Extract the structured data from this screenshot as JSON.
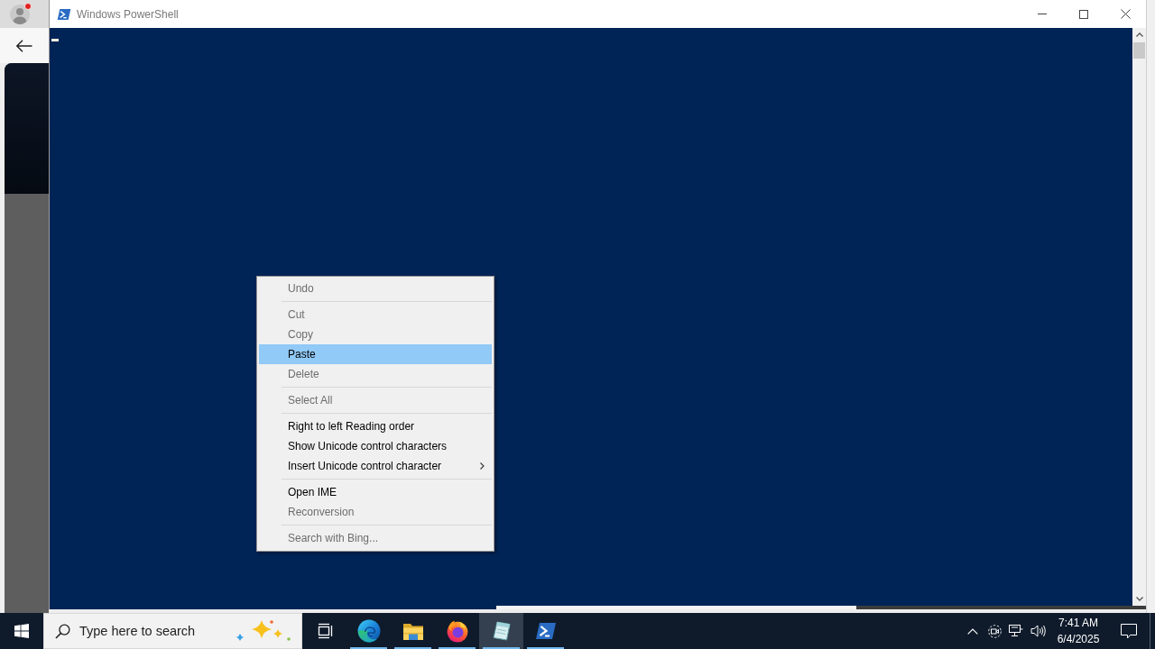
{
  "window": {
    "title": "Windows PowerShell"
  },
  "context_menu": {
    "groups": [
      {
        "items": [
          {
            "kind": "item",
            "label": "Undo",
            "disabled": true,
            "selected": false
          }
        ]
      },
      {
        "items": [
          {
            "kind": "item",
            "label": "Cut",
            "disabled": true,
            "selected": false
          },
          {
            "kind": "item",
            "label": "Copy",
            "disabled": true,
            "selected": false
          },
          {
            "kind": "item",
            "label": "Paste",
            "disabled": false,
            "selected": true
          },
          {
            "kind": "item",
            "label": "Delete",
            "disabled": true,
            "selected": false
          }
        ]
      },
      {
        "items": [
          {
            "kind": "item",
            "label": "Select All",
            "disabled": true,
            "selected": false
          }
        ]
      },
      {
        "items": [
          {
            "kind": "item",
            "label": "Right to left Reading order",
            "disabled": false,
            "selected": false
          },
          {
            "kind": "item",
            "label": "Show Unicode control characters",
            "disabled": false,
            "selected": false
          },
          {
            "kind": "submenu",
            "label": "Insert Unicode control character",
            "disabled": false,
            "selected": false
          }
        ]
      },
      {
        "items": [
          {
            "kind": "item",
            "label": "Open IME",
            "disabled": false,
            "selected": false
          },
          {
            "kind": "item",
            "label": "Reconversion",
            "disabled": true,
            "selected": false
          }
        ]
      },
      {
        "items": [
          {
            "kind": "item",
            "label": "Search with Bing...",
            "disabled": true,
            "selected": false
          }
        ]
      }
    ]
  },
  "taskbar": {
    "search": {
      "placeholder": "Type here to search"
    },
    "apps": [
      {
        "kind": "taskview",
        "running": false,
        "selected": false
      },
      {
        "kind": "swirl",
        "running": true,
        "selected": false
      },
      {
        "kind": "folder",
        "running": true,
        "selected": false
      },
      {
        "kind": "globe",
        "running": true,
        "selected": false
      },
      {
        "kind": "notepad",
        "running": true,
        "selected": true
      },
      {
        "kind": "terminal",
        "running": true,
        "selected": false
      }
    ],
    "clock": {
      "time": "7:41 AM",
      "date": "6/4/2025"
    }
  }
}
